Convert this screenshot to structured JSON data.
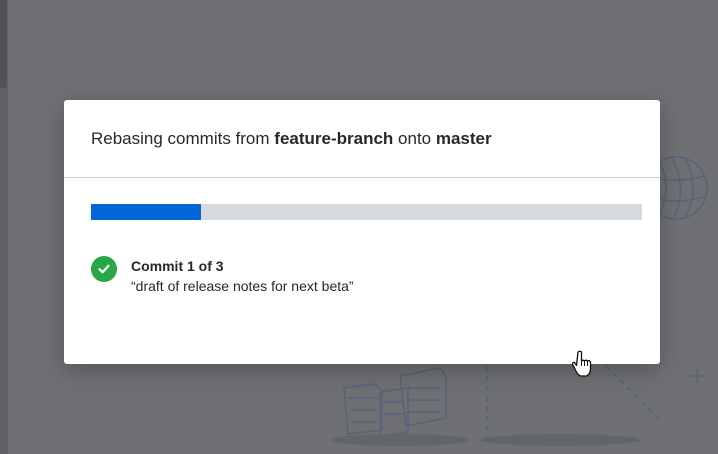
{
  "dialog": {
    "title_prefix": "Rebasing commits from ",
    "source_branch": "feature-branch",
    "title_middle": " onto ",
    "target_branch": "master"
  },
  "progress": {
    "fraction": 0.2,
    "fill_color": "#0366d6",
    "track_color": "#d6d9de"
  },
  "commit": {
    "status_icon": "check-circle-icon",
    "status_color": "#28a745",
    "count_label": "Commit 1 of 3",
    "message": "“draft of release notes for next beta”"
  },
  "cursor": {
    "icon": "hand-pointer-icon"
  }
}
